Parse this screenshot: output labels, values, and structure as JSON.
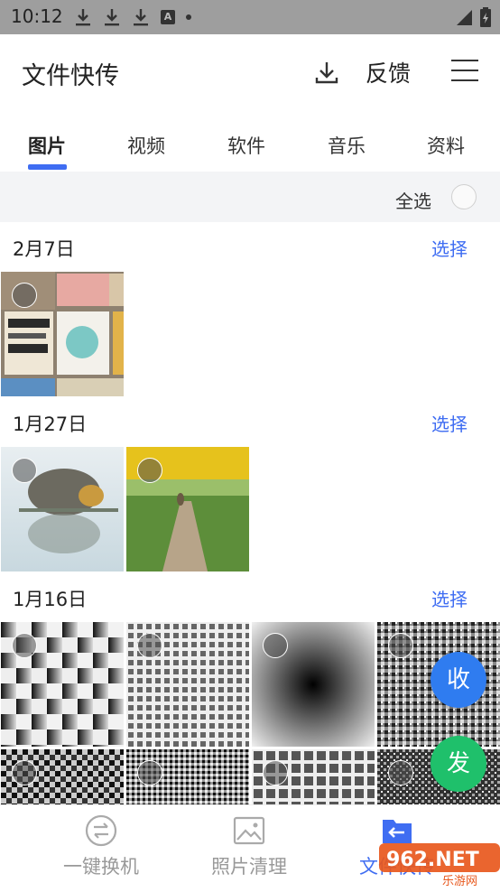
{
  "status_bar": {
    "time": "10:12",
    "icons": [
      "download-icon",
      "download-icon",
      "download-icon",
      "font-icon",
      "dot-icon",
      "signal-icon",
      "battery-icon"
    ]
  },
  "header": {
    "title": "文件快传",
    "download_icon": "download-icon",
    "feedback_label": "反馈",
    "menu_icon": "menu-icon"
  },
  "tabs": [
    {
      "label": "图片",
      "active": true
    },
    {
      "label": "视频",
      "active": false
    },
    {
      "label": "软件",
      "active": false
    },
    {
      "label": "音乐",
      "active": false
    },
    {
      "label": "资料",
      "active": false
    }
  ],
  "select_all": {
    "label": "全选"
  },
  "groups": [
    {
      "date": "2月7日",
      "action": "选择",
      "photo_count": 1
    },
    {
      "date": "1月27日",
      "action": "选择",
      "photo_count": 2
    },
    {
      "date": "1月16日",
      "action": "选择",
      "photo_count": 8
    }
  ],
  "fabs": {
    "receive": "收",
    "send": "发"
  },
  "bottom_nav": [
    {
      "label": "一键换机",
      "icon": "swap-icon",
      "active": false
    },
    {
      "label": "照片清理",
      "icon": "image-icon",
      "active": false
    },
    {
      "label": "文件快传",
      "icon": "folder-icon",
      "active": true
    }
  ],
  "watermark": {
    "text": "962.NET",
    "subtext": "乐游网"
  },
  "colors": {
    "accent": "#3f6df2",
    "receive": "#2f7cf0",
    "send": "#1fc06b",
    "status_bar": "#9e9e9e"
  }
}
